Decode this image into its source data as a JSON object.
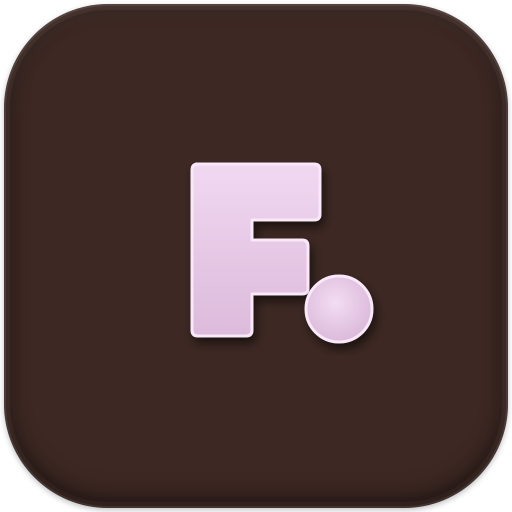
{
  "logo": {
    "letter": "F",
    "icon": "letter-f-with-dot-icon",
    "colors": {
      "background": "#3d2823",
      "glyph_fill": "#e9cbe9",
      "glyph_stroke": "#f7e4f6",
      "glyph_shadow": "#1e1210"
    }
  }
}
